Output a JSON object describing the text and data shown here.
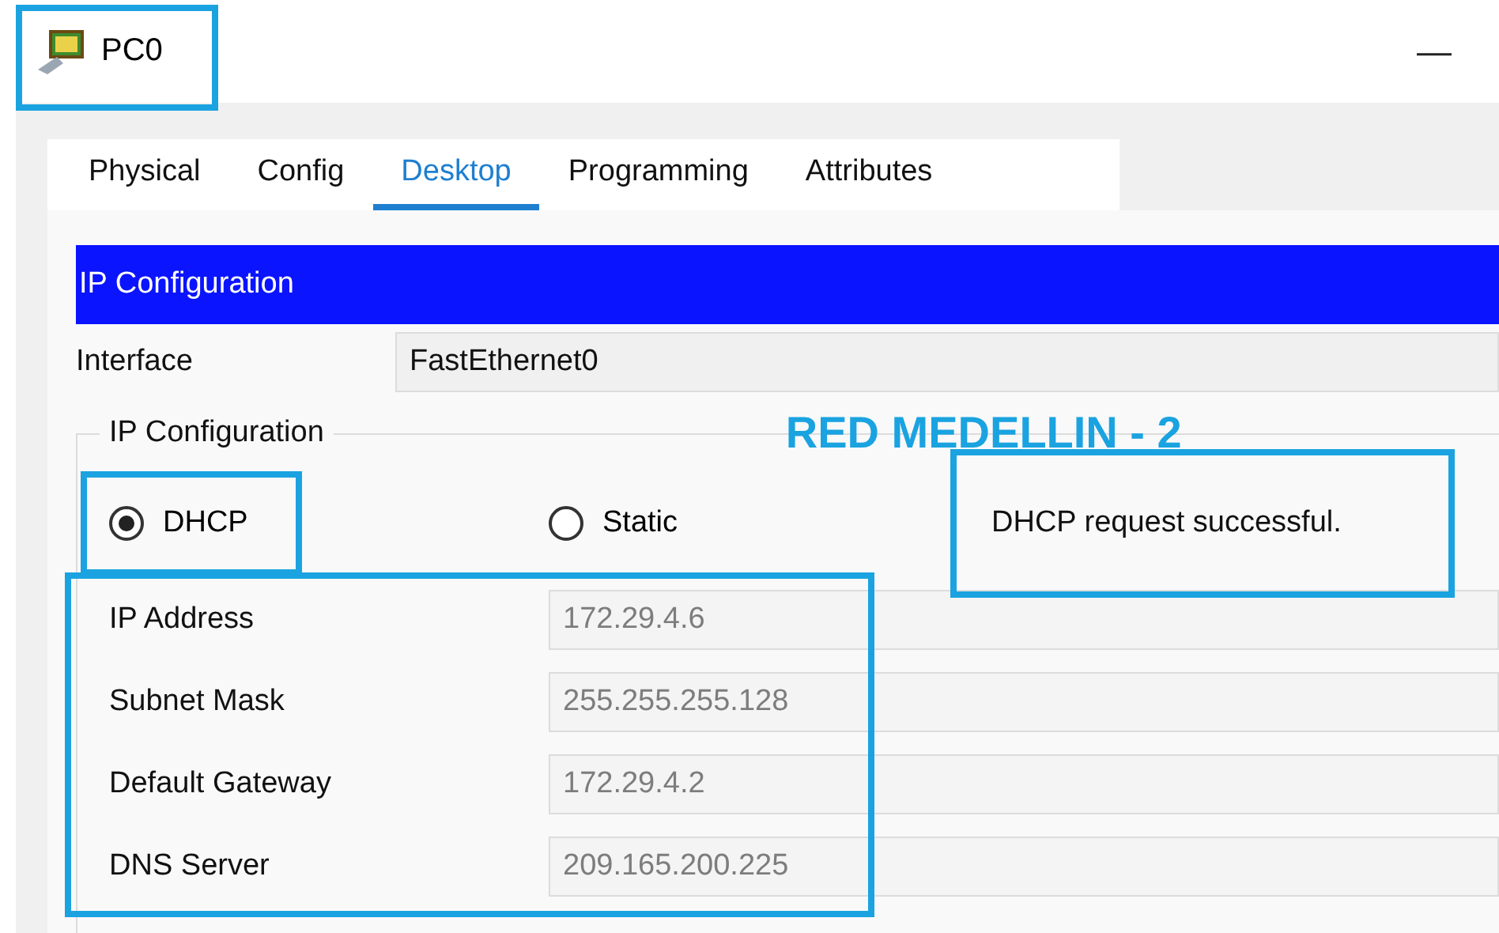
{
  "window": {
    "title": "PC0",
    "title_highlighted": true,
    "minimize": "—"
  },
  "tabs": [
    {
      "label": "Physical",
      "selected": false
    },
    {
      "label": "Config",
      "selected": false
    },
    {
      "label": "Desktop",
      "selected": true
    },
    {
      "label": "Programming",
      "selected": false
    },
    {
      "label": "Attributes",
      "selected": false
    }
  ],
  "panel": {
    "header": "IP Configuration",
    "interface_label": "Interface",
    "interface_value": "FastEthernet0"
  },
  "ip_group": {
    "legend": "IP Configuration",
    "annotation": "RED MEDELLIN - 2",
    "modes": [
      {
        "label": "DHCP",
        "selected": true,
        "highlighted": true
      },
      {
        "label": "Static",
        "selected": false
      }
    ],
    "status": {
      "text": "DHCP request successful.",
      "highlighted": true
    },
    "fields_highlighted": true,
    "fields": [
      {
        "label": "IP Address",
        "value": "172.29.4.6"
      },
      {
        "label": "Subnet Mask",
        "value": "255.255.255.128"
      },
      {
        "label": "Default Gateway",
        "value": "172.29.4.2"
      },
      {
        "label": "DNS Server",
        "value": "209.165.200.225"
      }
    ]
  }
}
